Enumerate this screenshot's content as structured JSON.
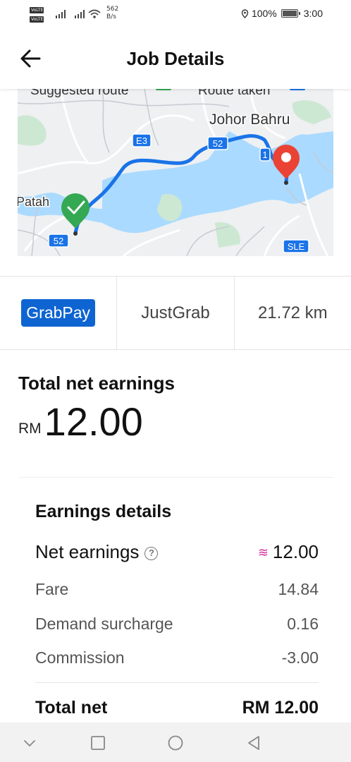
{
  "status_bar": {
    "sim1": "VoLTE",
    "sim2": "VoLTE",
    "net_speed_value": "562",
    "net_speed_unit": "B/s",
    "battery": "100%",
    "time": "3:00"
  },
  "header": {
    "title": "Job Details"
  },
  "map": {
    "legend_suggested": "Suggested route",
    "legend_taken": "Route taken",
    "labels": {
      "city": "Johor Bahru",
      "area": "Patah",
      "road_e3": "E3",
      "road_52a": "52",
      "road_52b": "52",
      "road_1": "1",
      "road_sle": "SLE"
    },
    "colors": {
      "route": "#1a73e8",
      "water": "#aadaff",
      "pickup": "#34a853",
      "dropoff": "#ea4335"
    }
  },
  "summary": {
    "payment": "GrabPay",
    "job_type": "JustGrab",
    "distance": "21.72 km"
  },
  "earnings": {
    "total_label": "Total net earnings",
    "currency": "RM",
    "total_value": "12.00",
    "details_title": "Earnings details",
    "rows": [
      {
        "label": "Net earnings",
        "value": "12.00"
      },
      {
        "label": "Fare",
        "value": "14.84"
      },
      {
        "label": "Demand surcharge",
        "value": "0.16"
      },
      {
        "label": "Commission",
        "value": "-3.00"
      }
    ],
    "total_net_label": "Total net",
    "total_net_value": "RM 12.00"
  },
  "nav": {
    "icons": [
      "chevron-down-icon",
      "square-icon",
      "circle-icon",
      "triangle-back-icon"
    ]
  }
}
